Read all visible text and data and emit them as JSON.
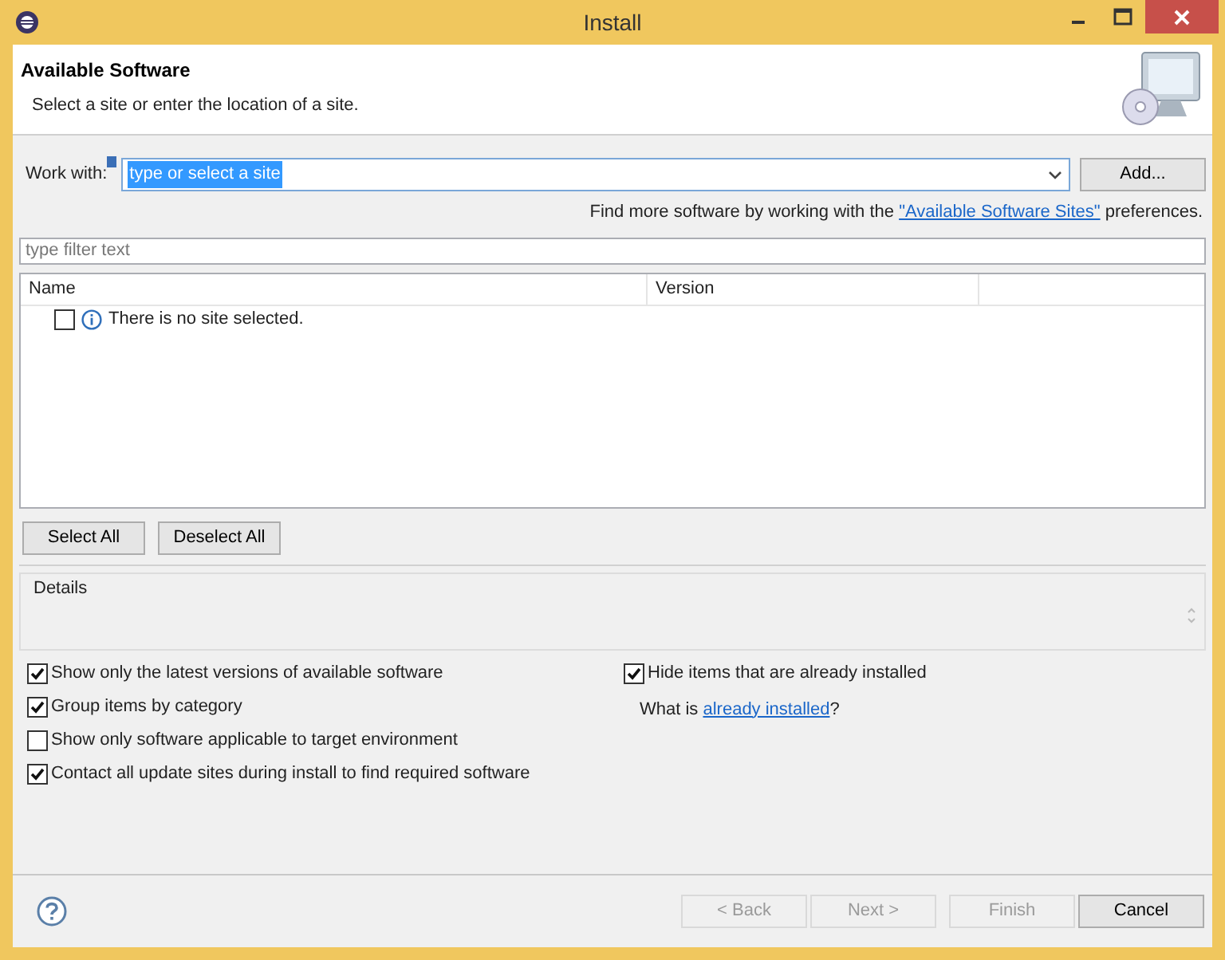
{
  "window": {
    "title": "Install"
  },
  "header": {
    "title": "Available Software",
    "subtitle": "Select a site or enter the location of a site."
  },
  "work_with": {
    "label": "Work with:",
    "value": "type or select a site",
    "text_selected": true,
    "add_button": "Add..."
  },
  "find_more": {
    "before": "Find more software by working with the",
    "link": "\"Available Software Sites\"",
    "after": "preferences."
  },
  "filter": {
    "placeholder": "type filter text"
  },
  "table": {
    "columns": [
      "Name",
      "Version"
    ],
    "rows": [
      {
        "checked": false,
        "text": "There is no site selected."
      }
    ]
  },
  "select_buttons": [
    "Select All",
    "Deselect All"
  ],
  "details": {
    "label": "Details"
  },
  "options_left": [
    {
      "label": "Show only the latest versions of available software",
      "checked": true
    },
    {
      "label": "Group items by category",
      "checked": true
    },
    {
      "label": "Show only software applicable to target environment",
      "checked": false
    },
    {
      "label": "Contact all update sites during install to find required software",
      "checked": true
    }
  ],
  "hide_installed": {
    "label": "Hide items that are already installed",
    "checked": true
  },
  "what_is": {
    "before": "What is",
    "link": "already installed",
    "after": "?"
  },
  "footer_buttons": [
    {
      "label": "< Back",
      "disabled": true
    },
    {
      "label": "Next >",
      "disabled": true
    },
    {
      "label": "Finish",
      "disabled": true
    },
    {
      "label": "Cancel",
      "disabled": false
    }
  ]
}
